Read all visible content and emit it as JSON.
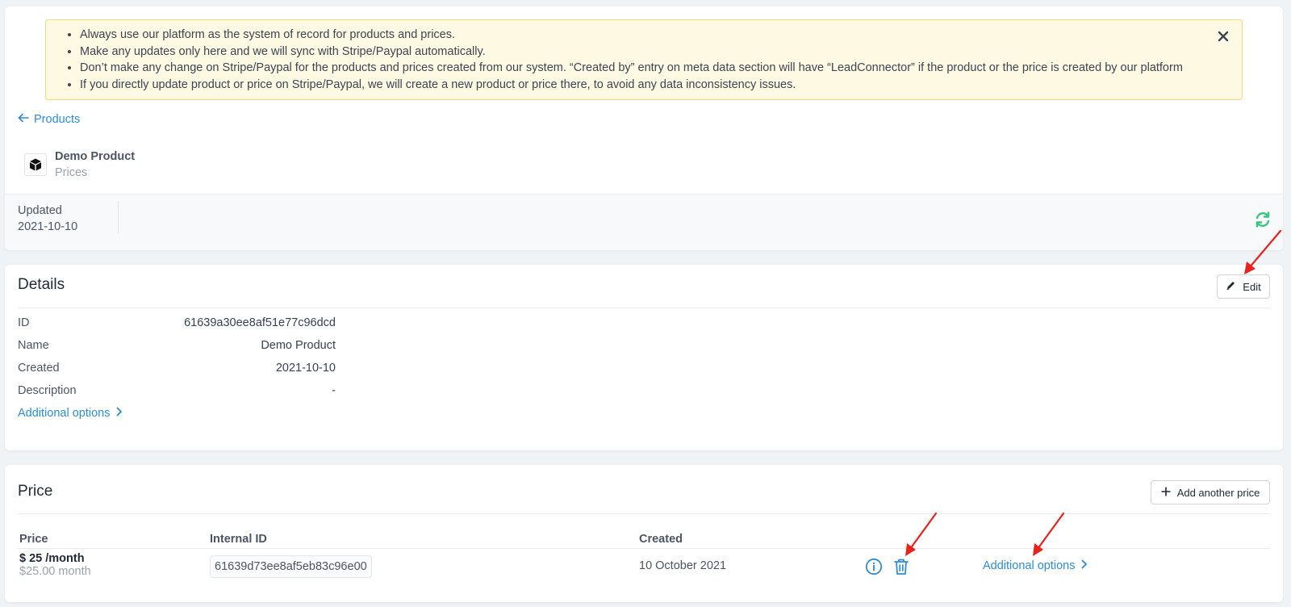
{
  "alert": {
    "items": [
      "Always use our platform as the system of record for products and prices.",
      "Make any updates only here and we will sync with Stripe/Paypal automatically.",
      "Don’t make any change on Stripe/Paypal for the products and prices created from our system. “Created by” entry on meta data section will have “LeadConnector” if the product or the price is created by our platform",
      "If you directly update product or price on Stripe/Paypal, we will create a new product or price there, to avoid any data inconsistency issues."
    ],
    "close_icon": "close-icon"
  },
  "nav": {
    "back_label": "Products",
    "back_icon": "arrow-left-icon"
  },
  "product": {
    "name": "Demo Product",
    "subtitle": "Prices",
    "icon": "box-icon"
  },
  "meta": {
    "updated_label": "Updated",
    "updated_value": "2021-10-10",
    "refresh_icon": "refresh-icon"
  },
  "details": {
    "title": "Details",
    "edit_label": "Edit",
    "rows": [
      {
        "label": "ID",
        "value": "61639a30ee8af51e77c96dcd"
      },
      {
        "label": "Name",
        "value": "Demo Product"
      },
      {
        "label": "Created",
        "value": "2021-10-10"
      },
      {
        "label": "Description",
        "value": "-"
      }
    ],
    "additional_options": "Additional options"
  },
  "price": {
    "title": "Price",
    "add_label": "Add another price",
    "columns": [
      "Price",
      "Internal ID",
      "Created"
    ],
    "rows": [
      {
        "price": "$ 25 /month",
        "price_sub": "$25.00 month",
        "internal_id": "61639d73ee8af5eb83c96e00",
        "created": "10 October 2021",
        "additional_options": "Additional options"
      }
    ]
  },
  "colors": {
    "link": "#2e8cd6",
    "alert_bg": "#fdf9e3",
    "alert_border": "#f2d77b",
    "refresh": "#34c77b",
    "annotation_arrow": "#e8221c"
  }
}
